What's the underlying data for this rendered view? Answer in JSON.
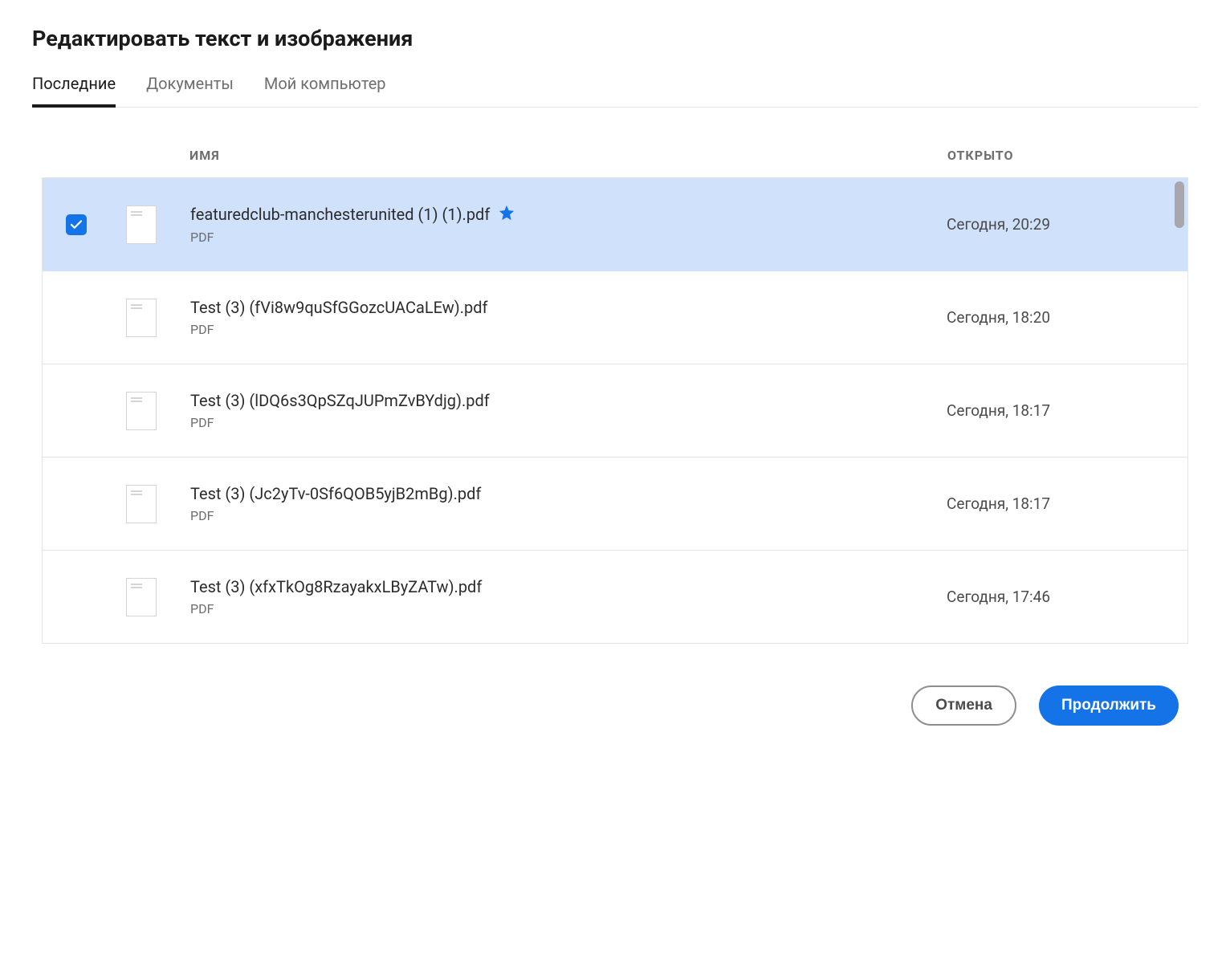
{
  "title": "Редактировать текст и изображения",
  "tabs": {
    "recent": "Последние",
    "documents": "Документы",
    "my_computer": "Мой компьютер",
    "active": 0
  },
  "columns": {
    "name": "ИМЯ",
    "opened": "ОТКРЫТО"
  },
  "files": [
    {
      "name": "featuredclub-manchesterunited (1) (1).pdf",
      "type": "PDF",
      "opened": "Сегодня, 20:29",
      "selected": true,
      "starred": true
    },
    {
      "name": "Test (3) (fVi8w9quSfGGozcUACaLEw).pdf",
      "type": "PDF",
      "opened": "Сегодня, 18:20",
      "selected": false,
      "starred": false
    },
    {
      "name": "Test (3) (lDQ6s3QpSZqJUPmZvBYdjg).pdf",
      "type": "PDF",
      "opened": "Сегодня, 18:17",
      "selected": false,
      "starred": false
    },
    {
      "name": "Test (3) (Jc2yTv-0Sf6QOB5yjB2mBg).pdf",
      "type": "PDF",
      "opened": "Сегодня, 18:17",
      "selected": false,
      "starred": false
    },
    {
      "name": "Test (3) (xfxTkOg8RzayakxLByZATw).pdf",
      "type": "PDF",
      "opened": "Сегодня, 17:46",
      "selected": false,
      "starred": false
    }
  ],
  "buttons": {
    "cancel": "Отмена",
    "continue": "Продолжить"
  }
}
